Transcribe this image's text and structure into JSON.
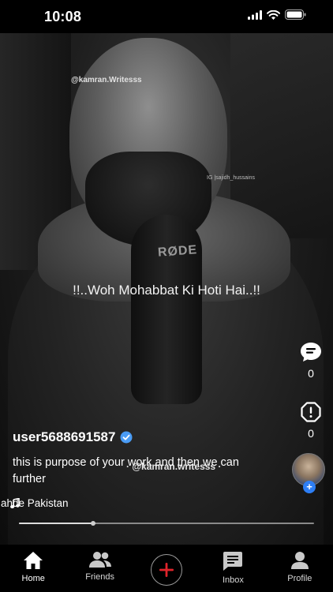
{
  "status_bar": {
    "time": "10:08",
    "icons": [
      "signal-icon",
      "wifi-icon",
      "battery-icon"
    ]
  },
  "video": {
    "watermark_top": "@kamran.Writesss",
    "watermark_ig": "IG |sajidh_hussains",
    "overlay_text": "!!..Woh Mohabbat Ki Hoti Hai..!!",
    "mic_label": "RØDE",
    "watermark_bottom": "· @kamran.writesss ·",
    "progress": 0.25
  },
  "side_actions": {
    "comments": {
      "icon": "comment-icon",
      "count": "0"
    },
    "report": {
      "icon": "alert-icon",
      "count": "0"
    }
  },
  "post": {
    "username": "user5688691587",
    "verified": true,
    "caption": "this is purpose of your work and then we can further",
    "music_text": "ahde Pakistan"
  },
  "tabs": [
    {
      "label": "Home",
      "icon": "home-icon",
      "active": true
    },
    {
      "label": "Friends",
      "icon": "friends-icon",
      "active": false
    },
    {
      "label": "",
      "icon": "plus-icon",
      "active": false
    },
    {
      "label": "Inbox",
      "icon": "inbox-icon",
      "active": false
    },
    {
      "label": "Profile",
      "icon": "profile-icon",
      "active": false
    }
  ],
  "colors": {
    "accent_red": "#e0242b",
    "verified_blue": "#2d7ef5"
  }
}
